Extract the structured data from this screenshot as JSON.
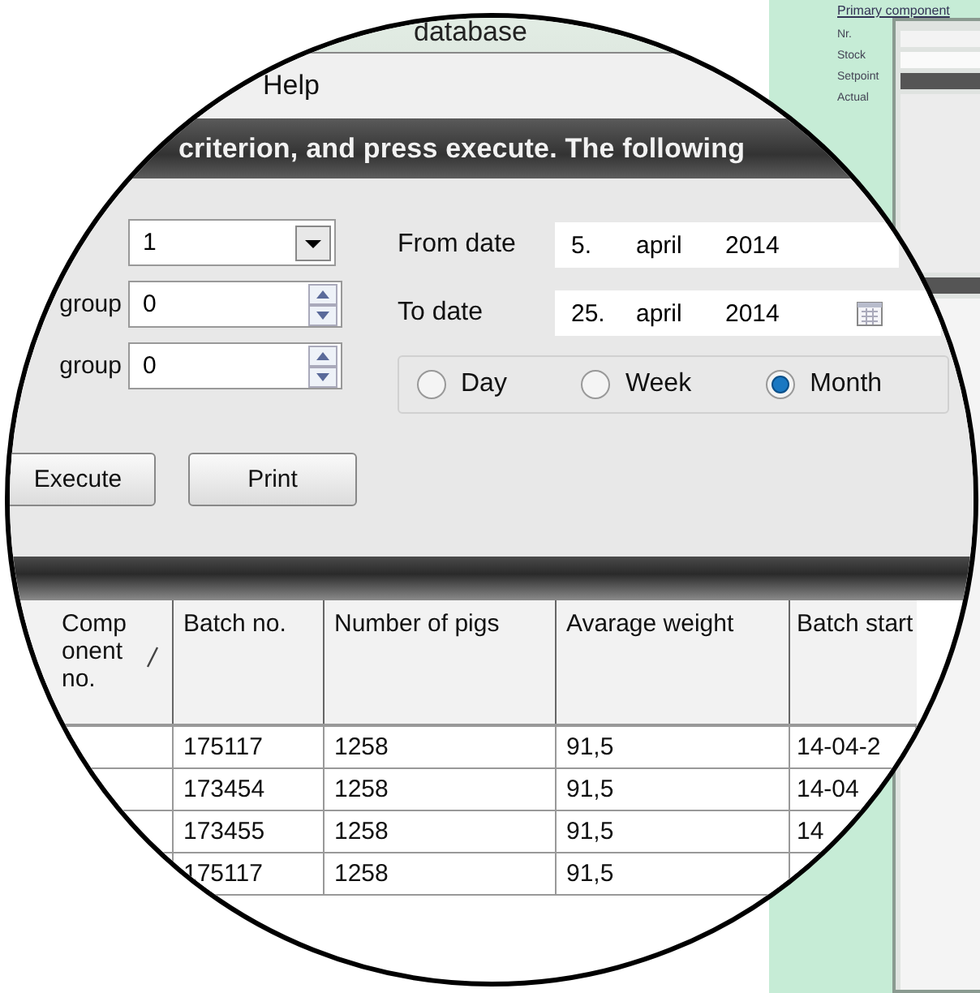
{
  "title_bar": {
    "title": "database"
  },
  "menu": {
    "items": [
      "Help"
    ]
  },
  "banner": {
    "text": "criterion, and press execute. The following"
  },
  "filters": [
    {
      "kind": "combo",
      "value": "1"
    },
    {
      "label": "group",
      "kind": "spin",
      "value": "0"
    },
    {
      "label": "group",
      "kind": "spin",
      "value": "0"
    }
  ],
  "dates": [
    {
      "label": "From date",
      "day": "5.",
      "month": "april",
      "year": "2014",
      "calendar_button": false
    },
    {
      "label": "To date",
      "day": "25.",
      "month": "april",
      "year": "2014",
      "calendar_button": true
    }
  ],
  "period": [
    {
      "label": "Day",
      "selected": false
    },
    {
      "label": "Week",
      "selected": false
    },
    {
      "label": "Month",
      "selected": true
    }
  ],
  "buttons": [
    "Execute",
    "Print"
  ],
  "table": {
    "columns": [
      {
        "label": "Comp onent no.",
        "sorted": true
      },
      {
        "label": "Batch no.",
        "sorted": false
      },
      {
        "label": "Number of pigs",
        "sorted": false
      },
      {
        "label": "Avarage weight",
        "sorted": false
      },
      {
        "label": "Batch start",
        "sorted": false
      }
    ],
    "rows": [
      {
        "batch_no": "175117",
        "pigs": "1258",
        "weight": "91,5",
        "start": "14-04-2"
      },
      {
        "batch_no": "173454",
        "pigs": "1258",
        "weight": "91,5",
        "start": "14-04"
      },
      {
        "batch_no": "173455",
        "pigs": "1258",
        "weight": "91,5",
        "start": "14"
      },
      {
        "batch_no": "175117",
        "pigs": "1258",
        "weight": "91,5"
      }
    ]
  },
  "background_window": {
    "link": "Primary component",
    "labels": [
      "Nr.",
      "Stock",
      "Setpoint",
      "Actual"
    ]
  }
}
